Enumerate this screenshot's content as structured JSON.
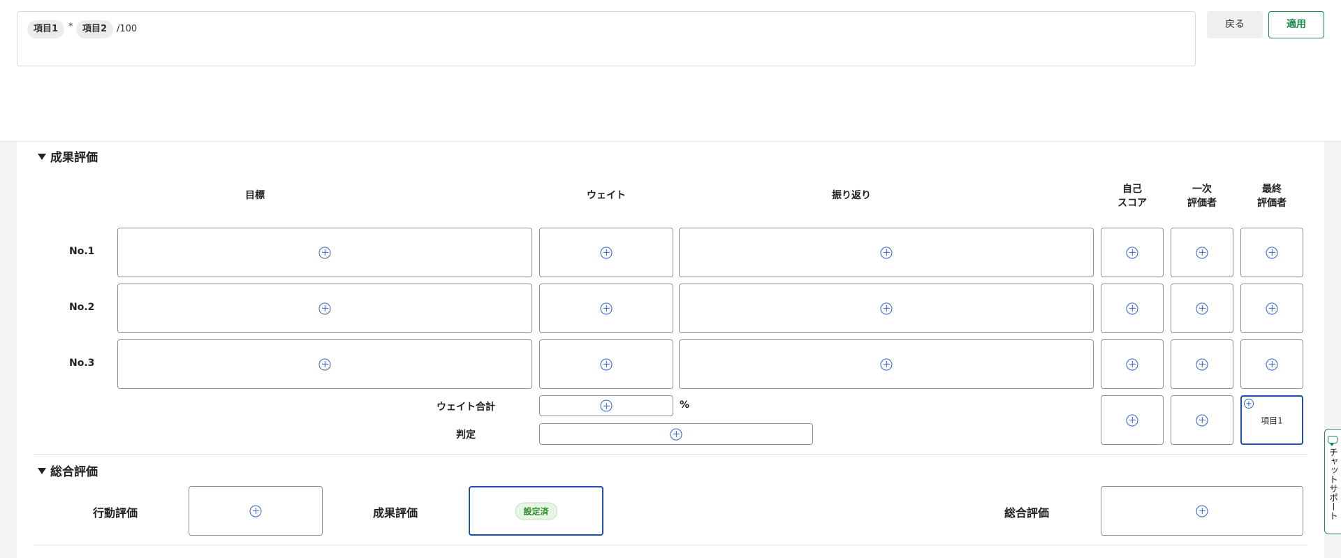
{
  "formula": {
    "chips": [
      "項目1",
      "項目2"
    ],
    "operator": "*",
    "suffix": "/100"
  },
  "buttons": {
    "back": "戻る",
    "apply": "適用"
  },
  "performance": {
    "title": "成果評価",
    "columns": {
      "goal": "目標",
      "weight": "ウェイト",
      "reflection": "振り返り",
      "self_score": [
        "自己",
        "スコア"
      ],
      "first_evaluator": [
        "一次",
        "評価者"
      ],
      "final_evaluator": [
        "最終",
        "評価者"
      ]
    },
    "rows": [
      "No.1",
      "No.2",
      "No.3"
    ],
    "weight_total_label": "ウェイト合計",
    "percent_sign": "%",
    "judgement_label": "判定",
    "final_cell_text": "項目1"
  },
  "overall": {
    "title": "総合評価",
    "behavior_label": "行動評価",
    "performance_label": "成果評価",
    "performance_badge": "設定済",
    "total_label": "総合評価"
  },
  "chat_support": {
    "label": "チャットサポート"
  },
  "colors": {
    "accent_green": "#1a8a4e",
    "accent_blue": "#2a64cc",
    "selected_border": "#1d4fb3"
  }
}
